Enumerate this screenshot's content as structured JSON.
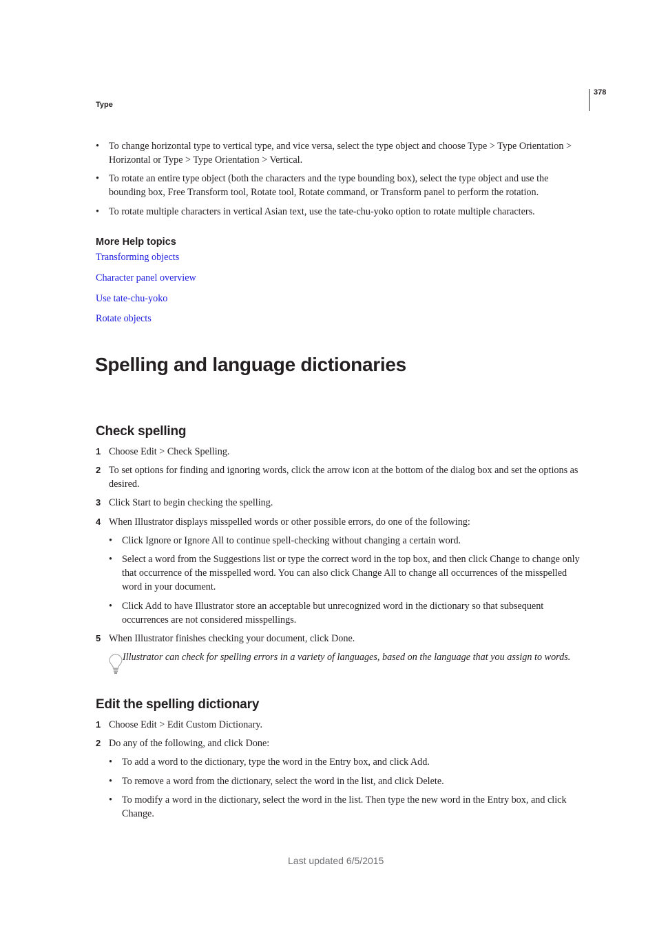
{
  "header": {
    "running_head": "Type",
    "page_number": "378"
  },
  "intro_bullets": [
    "To change horizontal type to vertical type, and vice versa, select the type object and choose Type > Type Orientation > Horizontal or Type > Type Orientation > Vertical.",
    "To rotate an entire type object (both the characters and the type bounding box), select the type object and use the bounding box, Free Transform tool, Rotate tool, Rotate command, or Transform panel to perform the rotation.",
    "To rotate multiple characters in vertical Asian text, use the tate-chu-yoko option to rotate multiple characters."
  ],
  "more_help": {
    "title": "More Help topics",
    "links": [
      "Transforming objects",
      "Character panel overview",
      "Use tate-chu-yoko",
      "Rotate objects"
    ]
  },
  "section_title": "Spelling and language dictionaries",
  "check_spelling": {
    "title": "Check spelling",
    "steps": [
      {
        "num": "1",
        "text": "Choose Edit > Check Spelling."
      },
      {
        "num": "2",
        "text": "To set options for finding and ignoring words, click the arrow icon at the bottom of the dialog box and set the options as desired."
      },
      {
        "num": "3",
        "text": "Click Start to begin checking the spelling."
      },
      {
        "num": "4",
        "text": "When Illustrator displays misspelled words or other possible errors, do one of the following:"
      },
      {
        "num": "5",
        "text": "When Illustrator finishes checking your document, click Done."
      }
    ],
    "sub_bullets": [
      "Click Ignore or Ignore All to continue spell-checking without changing a certain word.",
      "Select a word from the Suggestions list or type the correct word in the top box, and then click Change to change only that occurrence of the misspelled word. You can also click Change All to change all occurrences of the misspelled word in your document.",
      "Click Add to have Illustrator store an acceptable but unrecognized word in the dictionary so that subsequent occurrences are not considered misspellings."
    ],
    "tip": "Illustrator can check for spelling errors in a variety of languages, based on the language that you assign to words.",
    "tip_icon": "lightbulb-icon"
  },
  "edit_dictionary": {
    "title": "Edit the spelling dictionary",
    "steps": [
      {
        "num": "1",
        "text": "Choose Edit > Edit Custom Dictionary."
      },
      {
        "num": "2",
        "text": "Do any of the following, and click Done:"
      }
    ],
    "sub_bullets": [
      "To add a word to the dictionary, type the word in the Entry box, and click Add.",
      "To remove a word from the dictionary, select the word in the list, and click Delete.",
      "To modify a word in the dictionary, select the word in the list. Then type the new word in the Entry box, and click Change."
    ]
  },
  "footer": {
    "last_updated": "Last updated 6/5/2015"
  }
}
